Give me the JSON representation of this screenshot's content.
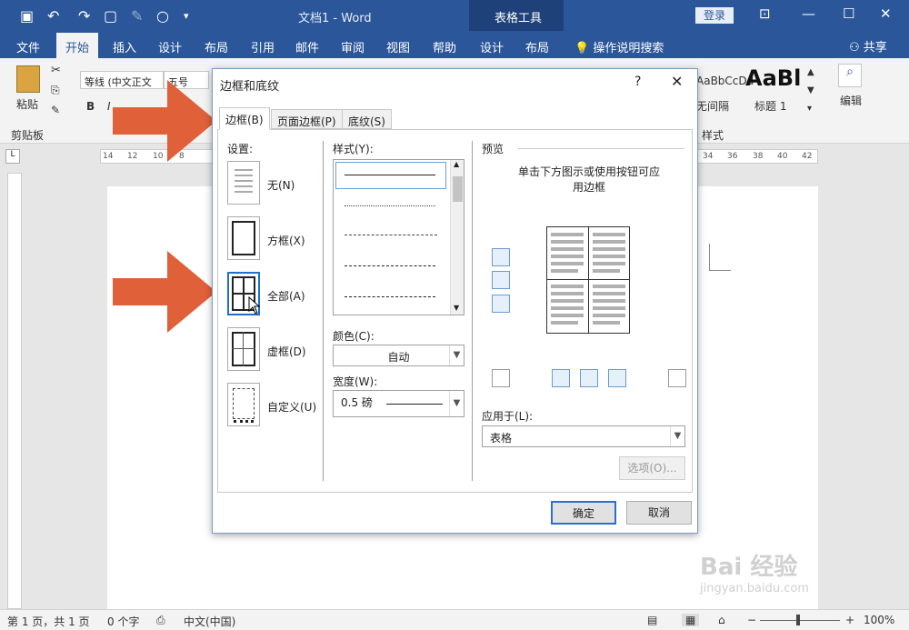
{
  "window": {
    "title": "文档1  -  Word",
    "context_tool": "表格工具",
    "login": "登录"
  },
  "tabs": [
    "文件",
    "开始",
    "插入",
    "设计",
    "布局",
    "引用",
    "邮件",
    "审阅",
    "视图",
    "帮助",
    "设计",
    "布局"
  ],
  "tell_me": "操作说明搜索",
  "share": "共享",
  "ribbon": {
    "paste": "粘贴",
    "clipboard": "剪贴板",
    "font_name": "等线 (中文正文",
    "font_size": "五号",
    "styles_sample1": "AaBbCcDd",
    "styles_sample1_label": "无间隔",
    "styles_sample2": "AaBl",
    "styles_sample2_label": "标题 1",
    "styles_group": "样式",
    "edit": "编辑"
  },
  "ruler_labels": [
    "14",
    "12",
    "10",
    "8",
    "34",
    "36",
    "38",
    "40",
    "42"
  ],
  "dialog": {
    "title": "边框和底纹",
    "help": "?",
    "tabs": [
      "边框(B)",
      "页面边框(P)",
      "底纹(S)"
    ],
    "settings_label": "设置:",
    "settings": [
      "无(N)",
      "方框(X)",
      "全部(A)",
      "虚框(D)",
      "自定义(U)"
    ],
    "style_label": "样式(Y):",
    "color_label": "颜色(C):",
    "color_value": "自动",
    "width_label": "宽度(W):",
    "width_value": "0.5 磅",
    "preview_label": "预览",
    "preview_hint": "单击下方图示或使用按钮可应用边框",
    "apply_label": "应用于(L):",
    "apply_value": "表格",
    "options_button": "选项(O)...",
    "ok_button": "确定",
    "cancel_button": "取消"
  },
  "status": {
    "page": "第 1 页，共 1 页",
    "words": "0 个字",
    "lang": "中文(中国)",
    "zoom": "100%"
  },
  "colors": {
    "accent": "#2b579a",
    "arrow": "#e0603a"
  }
}
